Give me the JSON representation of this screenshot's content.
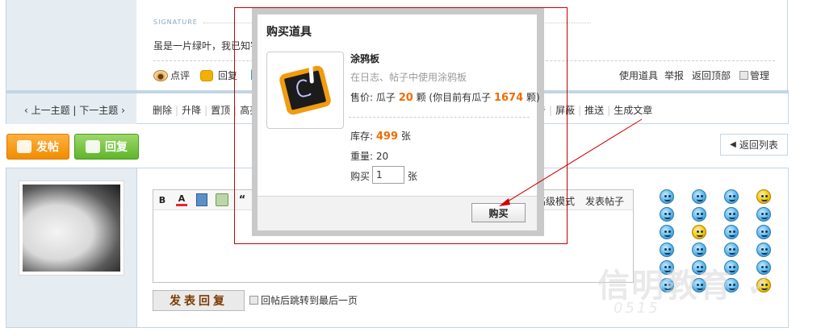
{
  "post": {
    "signature_label": "SIGNATURE",
    "signature_text": "虽是一片绿叶，我已知害",
    "actions_left": [
      "点评",
      "回复"
    ],
    "actions_right": [
      "使用道具",
      "举报",
      "返回顶部"
    ],
    "manage_label": "管理"
  },
  "thread_nav": {
    "prev_next": "‹ 上一主题 | 下一主题 ›",
    "mod_links_left": [
      "删除",
      "升降",
      "置顶",
      "高亮"
    ],
    "mod_links_right": [
      "屏蔽",
      "推送",
      "生成文章"
    ],
    "mod_fragment": "告"
  },
  "buttons": {
    "post": "发帖",
    "reply": "回复",
    "back_to_list": "返回列表"
  },
  "editor": {
    "advanced_mode": "高级模式",
    "post_thread": "发表帖子",
    "submit_reply": "发表回复",
    "jump_last_page": "回帖后跳转到最后一页"
  },
  "dialog": {
    "title": "购买道具",
    "item_name": "涂鸦板",
    "item_desc": "在日志、帖子中使用涂鸦板",
    "price_prefix": "售价: 瓜子",
    "price_value": "20",
    "price_middle": "颗 (你目前有瓜子",
    "balance_value": "1674",
    "price_suffix": "颗)",
    "stock_prefix": "库存:",
    "stock_value": "499",
    "stock_unit": "张",
    "weight": "重量: 20",
    "qty_label": "购买",
    "qty_value": "1",
    "qty_unit": "张",
    "buy_button": "购买"
  },
  "colors": {
    "accent_orange": "#f26c00",
    "highlight_red": "#c40000",
    "nav_blue": "#c2d5e3"
  }
}
